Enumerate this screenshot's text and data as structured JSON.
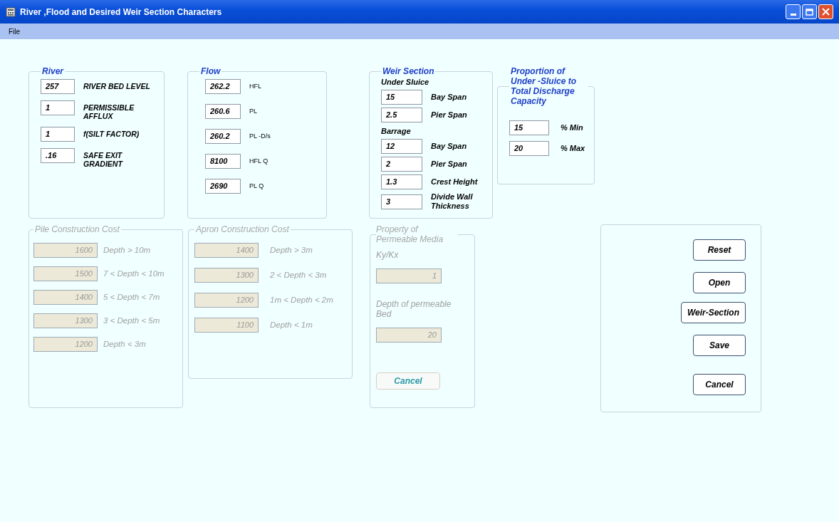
{
  "window": {
    "title": "River ,Flood and Desired Weir Section Characters"
  },
  "menu": [
    {
      "label": "File"
    }
  ],
  "river": {
    "title": "River",
    "fields": [
      {
        "value": "257",
        "label": "RIVER BED LEVEL"
      },
      {
        "value": "1",
        "label": "PERMISSIBLE AFFLUX"
      },
      {
        "value": "1",
        "label": "f(SILT FACTOR)"
      },
      {
        "value": ".16",
        "label": "SAFE EXIT GRADIENT"
      }
    ]
  },
  "flow": {
    "title": "Flow",
    "fields": [
      {
        "value": "262.2",
        "label": "HFL"
      },
      {
        "value": "260.6",
        "label": "PL"
      },
      {
        "value": "260.2",
        "label": "PL -D/s"
      },
      {
        "value": "8100",
        "label": "HFL Q"
      },
      {
        "value": "2690",
        "label": "PL Q"
      }
    ]
  },
  "weir_section": {
    "title": "Weir Section",
    "sections": [
      {
        "heading": "Under Sluice",
        "fields": [
          {
            "value": "15",
            "label": "Bay Span"
          },
          {
            "value": "2.5",
            "label": "Pier Span"
          }
        ]
      },
      {
        "heading": "Barrage",
        "fields": [
          {
            "value": "12",
            "label": "Bay Span"
          },
          {
            "value": "2",
            "label": "Pier Span"
          },
          {
            "value": "1.3",
            "label": "Crest Height"
          },
          {
            "value": "3",
            "label": "Divide Wall Thickness"
          }
        ]
      }
    ]
  },
  "proportion": {
    "title": "Proportion of Under -Sluice to Total Discharge Capacity",
    "fields": [
      {
        "value": "15",
        "label": "% Min"
      },
      {
        "value": "20",
        "label": "% Max"
      }
    ]
  },
  "pile_cost": {
    "title": "Pile Construction Cost",
    "disabled": true,
    "fields": [
      {
        "value": "1600",
        "label": "Depth > 10m"
      },
      {
        "value": "1500",
        "label": "7 < Depth < 10m"
      },
      {
        "value": "1400",
        "label": "5 < Depth < 7m"
      },
      {
        "value": "1300",
        "label": "3 < Depth < 5m"
      },
      {
        "value": "1200",
        "label": "Depth < 3m"
      }
    ]
  },
  "apron_cost": {
    "title": "Apron Construction Cost",
    "disabled": true,
    "fields": [
      {
        "value": "1400",
        "label": "Depth > 3m"
      },
      {
        "value": "1300",
        "label": "2 < Depth < 3m"
      },
      {
        "value": "1200",
        "label": "1m < Depth < 2m"
      },
      {
        "value": "1100",
        "label": "Depth < 1m"
      }
    ]
  },
  "permeable_media": {
    "title": "Property of Permeable Media",
    "disabled": true,
    "fields": [
      {
        "value": "1",
        "label": "Ky/Kx"
      },
      {
        "value": "20",
        "label": "Depth of permeable Bed"
      }
    ],
    "cancel_button": "Cancel"
  },
  "buttons": [
    "Reset",
    "Open",
    "Weir-Section",
    "Save",
    "Cancel"
  ]
}
